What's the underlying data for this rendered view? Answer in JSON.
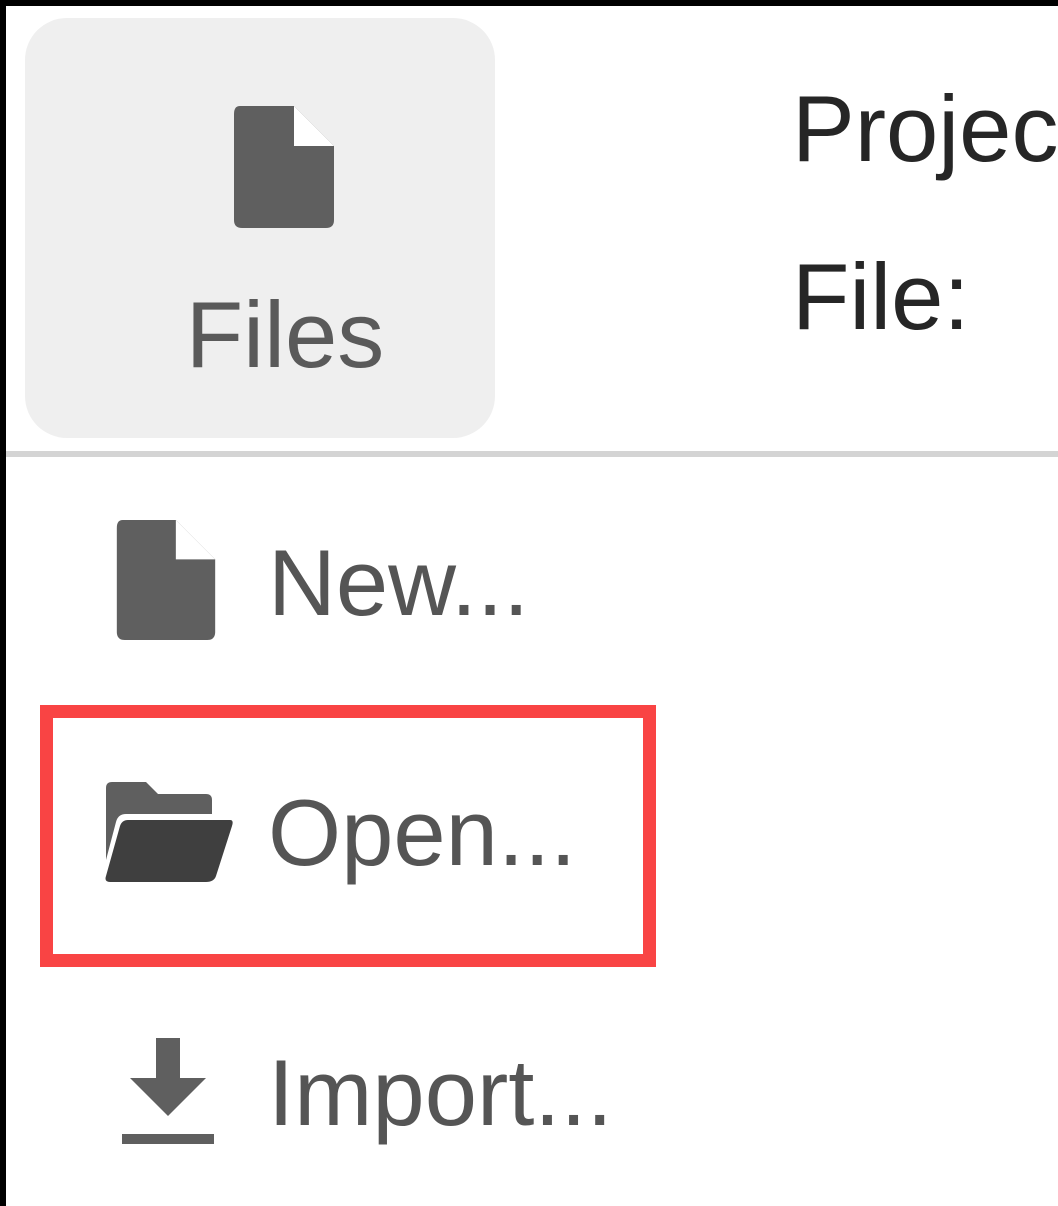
{
  "files_tab": {
    "label": "Files",
    "icon": "file-icon"
  },
  "project_info": {
    "project_label": "Projec",
    "file_label": "File:"
  },
  "menu": {
    "items": [
      {
        "label": "New...",
        "icon": "file-icon"
      },
      {
        "label": "Open...",
        "icon": "folder-open-icon"
      },
      {
        "label": "Import...",
        "icon": "download-icon"
      }
    ]
  },
  "colors": {
    "highlight": "#f94444",
    "icon": "#5f5f5f",
    "tab_background": "#efefef"
  }
}
